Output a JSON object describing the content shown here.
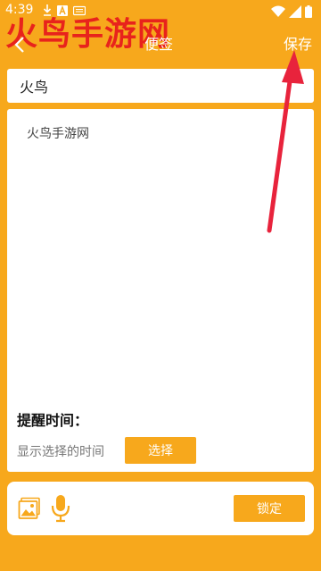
{
  "status_bar": {
    "time": "4:39"
  },
  "watermark": {
    "text": "火鸟手游网"
  },
  "header": {
    "title": "便签",
    "save_label": "保存"
  },
  "title_field": {
    "value": "火鸟"
  },
  "content": {
    "text": "火鸟手游网"
  },
  "reminder": {
    "label": "提醒时间：",
    "time_text": "显示选择的时间",
    "select_label": "选择"
  },
  "bottom_bar": {
    "lock_label": "锁定"
  },
  "colors": {
    "accent": "#f7a81c",
    "watermark": "#e8231c",
    "arrow": "#e8233c"
  }
}
